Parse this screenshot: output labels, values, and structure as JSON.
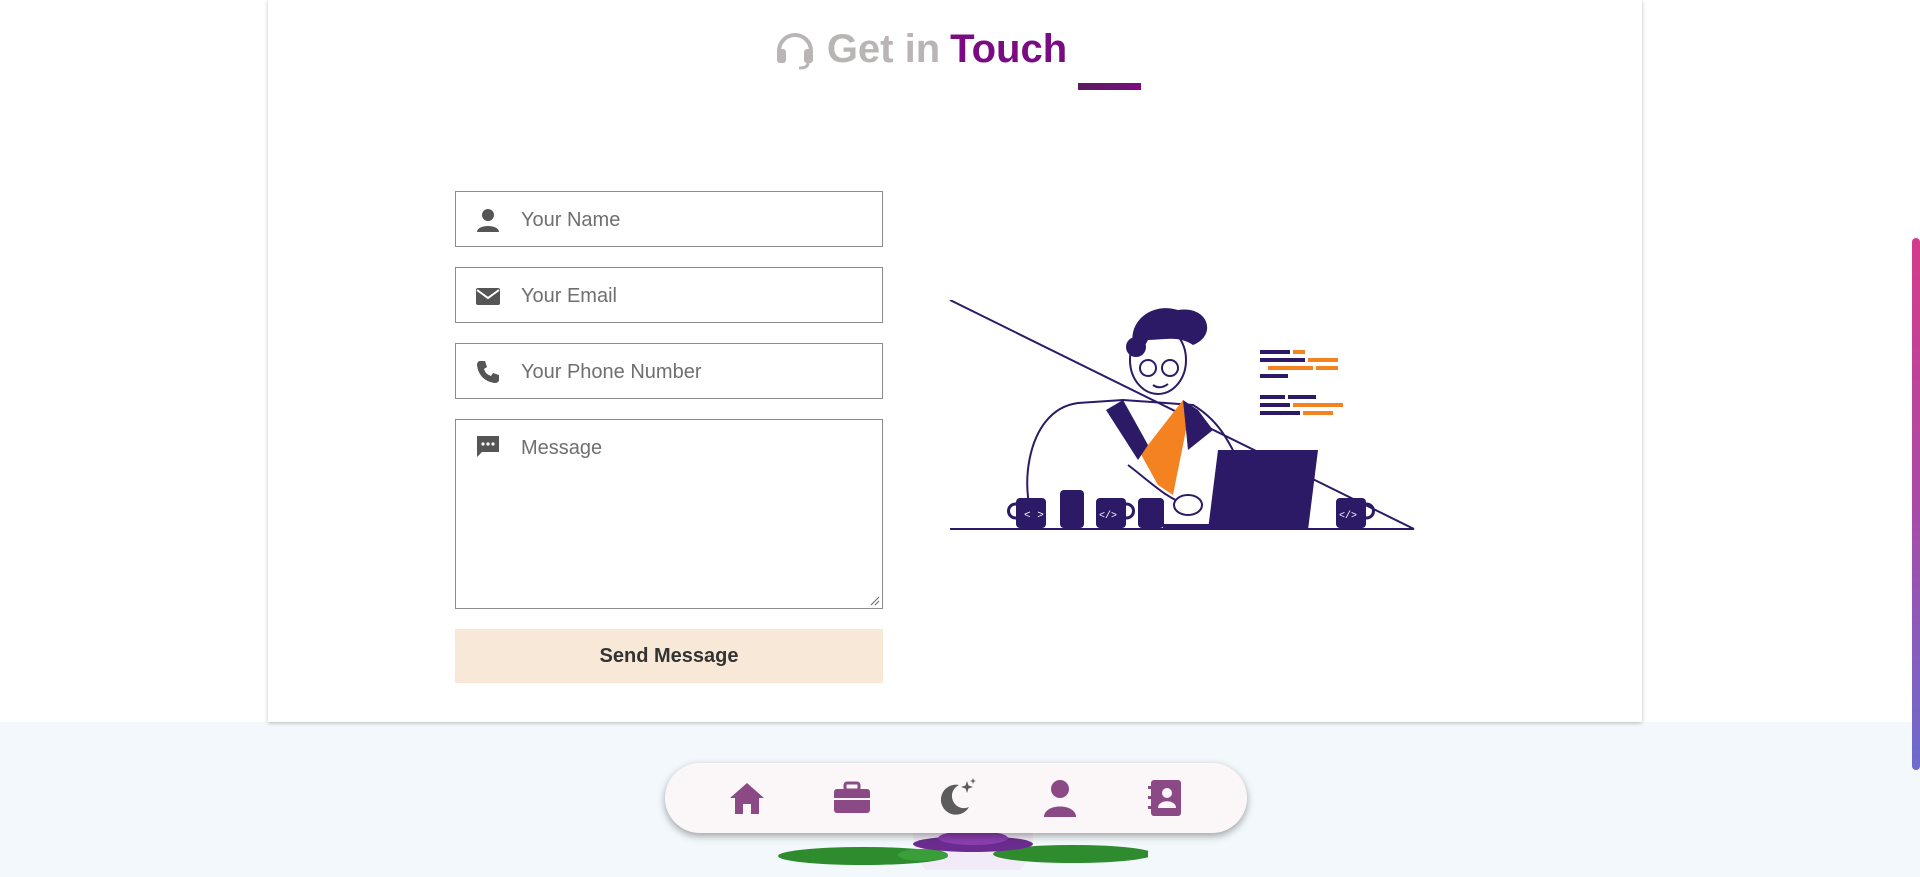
{
  "contact": {
    "heading_part1": "Get in",
    "heading_part2": "Touch",
    "heading_icon": "headset-icon",
    "name_placeholder": "Your Name",
    "email_placeholder": "Your Email",
    "phone_placeholder": "Your Phone Number",
    "message_placeholder": "Message",
    "send_label": "Send Message",
    "icons": {
      "name": "user-icon",
      "email": "envelope-icon",
      "phone": "phone-icon",
      "message": "chat-bubble-icon"
    }
  },
  "nav": {
    "items": [
      {
        "icon": "home-icon"
      },
      {
        "icon": "briefcase-icon"
      },
      {
        "icon": "moon-stars-icon"
      },
      {
        "icon": "user-icon"
      },
      {
        "icon": "contact-book-icon"
      }
    ]
  },
  "colors": {
    "accent": "#7b0b82",
    "heading_grey": "#b9b5b5",
    "button_bg": "#f7e8d7",
    "illustration_navy": "#2c1a66",
    "illustration_orange": "#f58220",
    "nav_icon": "#8b4a86"
  }
}
